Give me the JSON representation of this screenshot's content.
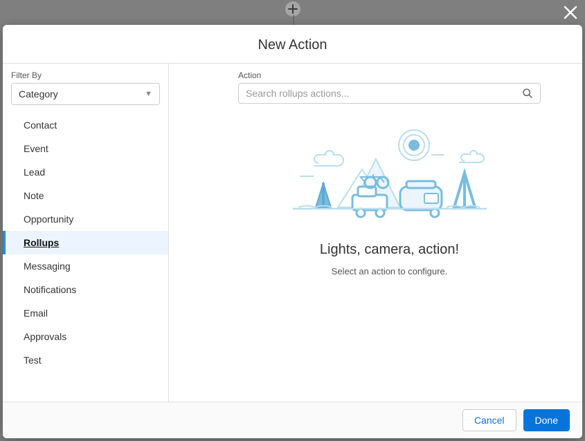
{
  "modal": {
    "title": "New Action",
    "footer": {
      "cancel": "Cancel",
      "done": "Done"
    }
  },
  "filter": {
    "label": "Filter By",
    "selected": "Category"
  },
  "categories": [
    {
      "label": "Contact",
      "selected": false
    },
    {
      "label": "Event",
      "selected": false
    },
    {
      "label": "Lead",
      "selected": false
    },
    {
      "label": "Note",
      "selected": false
    },
    {
      "label": "Opportunity",
      "selected": false
    },
    {
      "label": "Rollups",
      "selected": true
    },
    {
      "label": "Messaging",
      "selected": false
    },
    {
      "label": "Notifications",
      "selected": false
    },
    {
      "label": "Email",
      "selected": false
    },
    {
      "label": "Approvals",
      "selected": false
    },
    {
      "label": "Test",
      "selected": false
    }
  ],
  "action": {
    "label": "Action",
    "search_placeholder": "Search rollups actions..."
  },
  "empty": {
    "title": "Lights, camera, action!",
    "subtitle": "Select an action to configure."
  }
}
